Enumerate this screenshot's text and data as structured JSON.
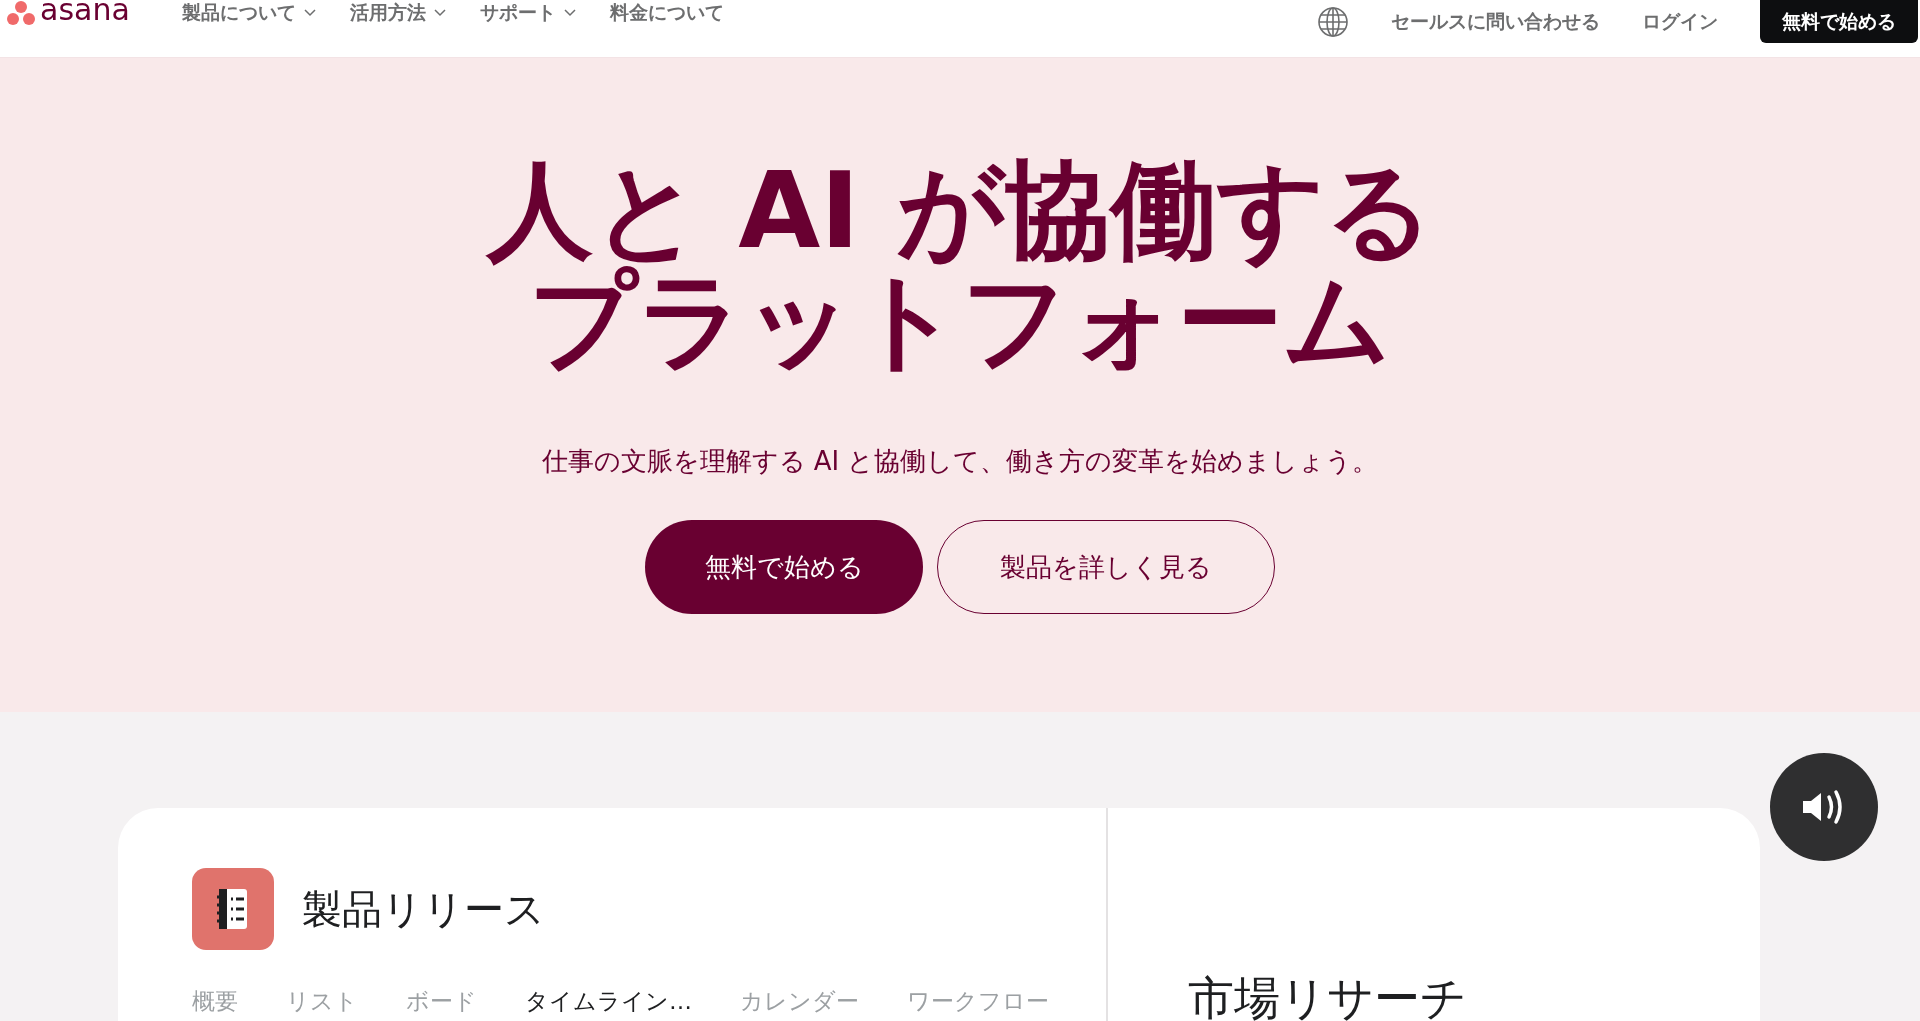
{
  "nav": {
    "logo": "asana",
    "menu": [
      {
        "label": "製品について",
        "dropdown": true
      },
      {
        "label": "活用方法",
        "dropdown": true
      },
      {
        "label": "サポート",
        "dropdown": true
      },
      {
        "label": "料金について",
        "dropdown": false
      }
    ],
    "contact": "セールスに問い合わせる",
    "login": "ログイン",
    "cta": "無料で始める"
  },
  "hero": {
    "title_lines": [
      "人と AI が協働する",
      "プラットフォーム"
    ],
    "subtitle": "仕事の文脈を理解する AI と協働して、働き方の変革を始めましょう。",
    "primary_button": "無料で始める",
    "secondary_button": "製品を詳しく見る"
  },
  "preview": {
    "project_title": "製品リリース",
    "tabs": [
      {
        "label": "概要",
        "selected": false
      },
      {
        "label": "リスト",
        "selected": false
      },
      {
        "label": "ボード",
        "selected": false
      },
      {
        "label": "タイムライン…",
        "selected": true
      },
      {
        "label": "カレンダー",
        "selected": false
      },
      {
        "label": "ワークフロー",
        "selected": false
      }
    ],
    "side_title": "市場リサーチ"
  }
}
